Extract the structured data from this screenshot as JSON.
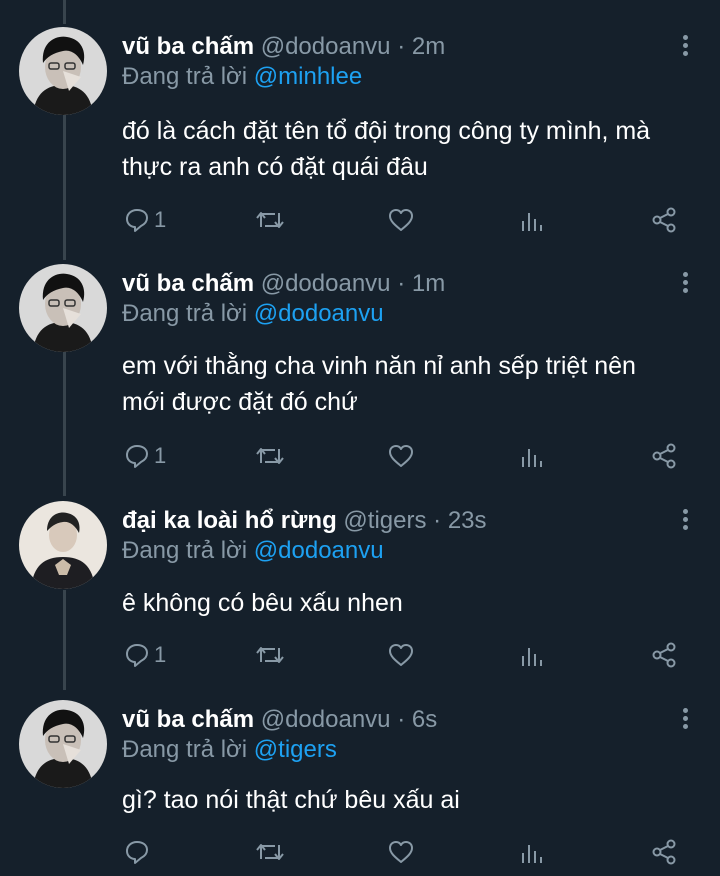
{
  "tweets": [
    {
      "name": "vũ ba chấm",
      "handle": "@dodoanvu",
      "time": "2m",
      "reply_prefix": "Đang trả lời",
      "reply_to": "@minhlee",
      "text_lines": [
        "đó là cách đặt tên tổ đội trong công ty mình, mà",
        "thực ra anh có đặt quái đâu"
      ],
      "reply_count": "1"
    },
    {
      "name": "vũ ba chấm",
      "handle": "@dodoanvu",
      "time": "1m",
      "reply_prefix": "Đang trả lời",
      "reply_to": "@dodoanvu",
      "text_lines": [
        "em với thằng cha vinh năn nỉ anh sếp triệt nên",
        "mới được đặt đó chứ"
      ],
      "reply_count": "1"
    },
    {
      "name": "đại ka loài hổ rừng",
      "handle": "@tigers",
      "time": "23s",
      "reply_prefix": "Đang trả lời",
      "reply_to": "@dodoanvu",
      "text_lines": [
        "ê không có bêu xấu nhen"
      ],
      "reply_count": "1"
    },
    {
      "name": "vũ ba chấm",
      "handle": "@dodoanvu",
      "time": "6s",
      "reply_prefix": "Đang trả lời",
      "reply_to": "@tigers",
      "text_lines": [
        "gì? tao nói thật chứ bêu xấu ai"
      ],
      "reply_count": ""
    }
  ],
  "separator": "·",
  "icons": [
    "reply-icon",
    "retweet-icon",
    "like-icon",
    "analytics-icon",
    "share-icon",
    "more-icon"
  ],
  "colors": {
    "background": "#15202b",
    "text": "#ffffff",
    "muted": "#8899a6",
    "link": "#1da1f2"
  }
}
